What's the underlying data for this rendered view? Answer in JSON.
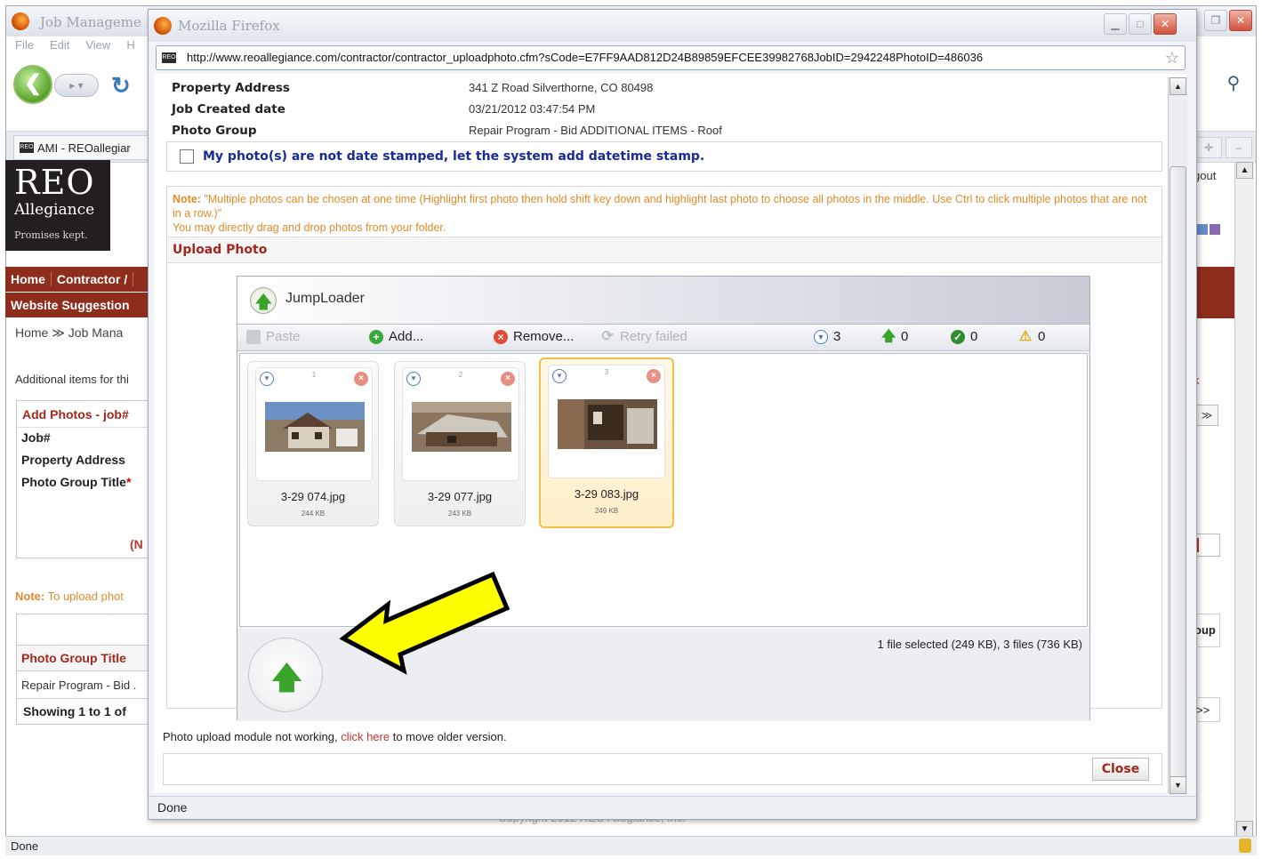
{
  "background_window": {
    "title": "Job Manageme",
    "menu": [
      "File",
      "Edit",
      "View",
      "H"
    ],
    "tab_label": "AMI - REOallegiar",
    "logo": {
      "line1": "REO",
      "line2": "Allegiance",
      "line3": "Promises kept."
    },
    "nav": {
      "home": "Home",
      "contractor": "Contractor /",
      "website_suggestion": "Website Suggestion"
    },
    "breadcrumb": "Home  ≫  Job Mana",
    "additional_items": "Additional items for thi",
    "form": {
      "heading": "Add Photos - job#",
      "rows": [
        "Job#",
        "Property Address",
        "Photo Group Title"
      ],
      "required_mark": "*",
      "n_text": "(N"
    },
    "note_label": "Note:",
    "note_text": " To upload phot",
    "table": {
      "header": "Photo Group Title",
      "row": "Repair Program - Bid .",
      "footer": "Showing 1 to 1 of"
    },
    "right": {
      "logout": "gout",
      "k": "k",
      "next": "≫",
      "oup": "oup",
      "next2": ">>"
    },
    "copyright": "Copyright 2012 REO Allegiance, Inc.",
    "status": "Done",
    "legend_colors": [
      "#6a8ac8",
      "#8a6ab0"
    ]
  },
  "popup": {
    "title": "Mozilla Firefox",
    "url": "http://www.reoallegiance.com/contractor/contractor_uploadphoto.cfm?sCode=E7FF9AAD812D24B89859EFCEE39982768JobID=2942248PhotoID=486036",
    "info": [
      {
        "label": "Property Address",
        "value": "341 Z Road Silverthorne, CO 80498"
      },
      {
        "label": "Job Created date",
        "value": "03/21/2012 03:47:54 PM"
      },
      {
        "label": "Photo Group",
        "value": "Repair Program - Bid ADDITIONAL ITEMS - Roof"
      }
    ],
    "stamp_label": "My photo(s) are not date stamped, let the system add datetime stamp.",
    "note": {
      "label": "Note:",
      "text": " \"Multiple photos can be chosen at one time (Highlight first photo then hold shift key down and highlight last photo to choose all photos in the middle. Use Ctrl to click multiple photos that are not in a row.)\"",
      "line2": "You may directly drag and drop photos from your folder."
    },
    "upload_heading": "Upload Photo",
    "jumploader": {
      "title": "JumpLoader",
      "toolbar": {
        "paste": "Paste",
        "add": "Add...",
        "remove": "Remove...",
        "retry": "Retry failed",
        "count_pending": "3",
        "count_uploading": "0",
        "count_done": "0",
        "count_failed": "0"
      },
      "files": [
        {
          "index": "1",
          "name": "3-29 074.jpg",
          "size": "244 KB",
          "selected": false
        },
        {
          "index": "2",
          "name": "3-29 077.jpg",
          "size": "243 KB",
          "selected": false
        },
        {
          "index": "3",
          "name": "3-29 083.jpg",
          "size": "249 KB",
          "selected": true
        }
      ],
      "status": "1 file selected (249 KB), 3 files (736 KB)"
    },
    "older_prefix": "Photo upload module not working, ",
    "older_link": "click here",
    "older_suffix": " to move older version.",
    "close_label": "Close",
    "status": "Done"
  }
}
